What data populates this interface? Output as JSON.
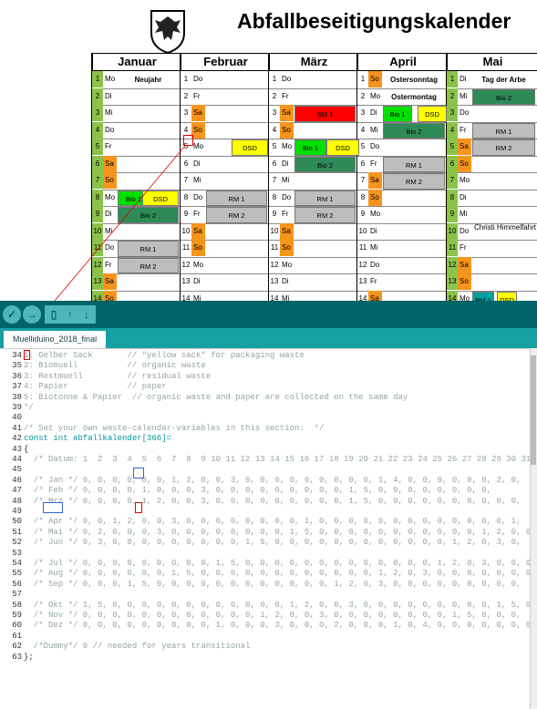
{
  "calendar": {
    "title": "Abfallbeseitigungskalender",
    "months": [
      "Januar",
      "Februar",
      "März",
      "April",
      "Mai"
    ],
    "rows": [
      [
        "1",
        "Mo",
        "Neujahr",
        "1",
        "Do",
        "",
        "1",
        "Do",
        "",
        "1",
        "So",
        "Ostersonntag",
        "1",
        "Di",
        "Tag der Arbe"
      ],
      [
        "2",
        "Di",
        "",
        "2",
        "Fr",
        "",
        "2",
        "Fr",
        "",
        "2",
        "Mo",
        "Ostermontag",
        "2",
        "Mi",
        "Bio 2"
      ],
      [
        "3",
        "Mi",
        "",
        "3",
        "Sa",
        "",
        "3",
        "Sa",
        "SM 1",
        "3",
        "Di",
        "Bio 1",
        "3",
        "Do",
        ""
      ],
      [
        "4",
        "Do",
        "",
        "4",
        "So",
        "",
        "4",
        "So",
        "",
        "4",
        "Mi",
        "Bio 2",
        "4",
        "Fr",
        "RM 1"
      ],
      [
        "5",
        "Fr",
        "",
        "5",
        "Mo",
        "DSD",
        "5",
        "Mo",
        "Bio 1",
        "5",
        "Do",
        "",
        "5",
        "Sa",
        "RM 2"
      ],
      [
        "6",
        "Sa",
        "",
        "6",
        "Di",
        "",
        "6",
        "Di",
        "Bio 2",
        "6",
        "Fr",
        "RM 1",
        "6",
        "So",
        ""
      ],
      [
        "7",
        "So",
        "",
        "7",
        "Mi",
        "",
        "7",
        "Mi",
        "",
        "7",
        "Sa",
        "RM 2",
        "7",
        "Mo",
        ""
      ],
      [
        "8",
        "Mo",
        "Bio 1",
        "8",
        "Do",
        "RM 1",
        "8",
        "Do",
        "RM 1",
        "8",
        "So",
        "",
        "8",
        "Di",
        ""
      ],
      [
        "9",
        "Di",
        "Bio 2",
        "9",
        "Fr",
        "RM 2",
        "9",
        "Fr",
        "RM 2",
        "9",
        "Mo",
        "",
        "9",
        "Mi",
        ""
      ],
      [
        "10",
        "Mi",
        "",
        "10",
        "Sa",
        "",
        "10",
        "Sa",
        "",
        "10",
        "Di",
        "",
        "10",
        "Do",
        "Christi Himmelfahrt"
      ],
      [
        "11",
        "Do",
        "RM 1",
        "11",
        "So",
        "",
        "11",
        "So",
        "",
        "11",
        "Mi",
        "",
        "11",
        "Fr",
        ""
      ],
      [
        "12",
        "Fr",
        "RM 2",
        "12",
        "Mo",
        "",
        "12",
        "Mo",
        "",
        "12",
        "Do",
        "",
        "12",
        "Sa",
        ""
      ],
      [
        "13",
        "Sa",
        "",
        "13",
        "Di",
        "",
        "13",
        "Di",
        "",
        "13",
        "Fr",
        "",
        "13",
        "So",
        ""
      ],
      [
        "14",
        "So",
        "",
        "14",
        "Mi",
        "",
        "14",
        "Mi",
        "",
        "14",
        "Sa",
        "",
        "14",
        "Mo",
        "PM 1"
      ]
    ],
    "extra_labels": {
      "dsd": "DSD",
      "christi": "Christi",
      "himmelfahrt": "Himmelfahrt"
    },
    "colors": {
      "green_light": "#8bc34a",
      "weekend_orange": "#f7941d",
      "bio1_green": "#00e000",
      "bio2_green": "#2e8b57",
      "dsd_yellow": "#ffff00",
      "rm_grey": "#bdbdbd",
      "sm_red": "#ff0000",
      "pm_teal": "#00a0a0"
    }
  },
  "ide": {
    "tab_label": "Muelliduino_2018_final",
    "toolbar": [
      "verify",
      "upload",
      "new",
      "open",
      "save"
    ],
    "lines": [
      {
        "n": "34",
        "t": "1: Gelber Sack       // \"yellow sack\" for packaging waste"
      },
      {
        "n": "35",
        "t": "2: Biomuell          // organic waste"
      },
      {
        "n": "36",
        "t": "3: Restmuell         // residual waste"
      },
      {
        "n": "37",
        "t": "4: Papier            // paper"
      },
      {
        "n": "38",
        "t": "5: Biotonne & Papier  // organic waste and paper are collected on the same day"
      },
      {
        "n": "39",
        "t": "*/"
      },
      {
        "n": "40",
        "t": ""
      },
      {
        "n": "41",
        "t": "/* Set your own waste-calendar-variables in this section:  */"
      },
      {
        "n": "42",
        "t": "const int abfallkalender[366]="
      },
      {
        "n": "43",
        "t": "{"
      },
      {
        "n": "44",
        "t": "  /* Datum: 1  2  3  4  5  6  7  8  9 10 11 12 13 14 15 16 17 18 19 20 21 22 23 24 25 26 27 28 29 30 31 */"
      },
      {
        "n": "45",
        "t": ""
      },
      {
        "n": "46",
        "t": "  /* Jan */ 0, 0, 0, 0, 0, 0, 1, 2, 0, 0, 3, 0, 0, 0, 0, 0, 0, 0, 0, 0, 1, 4, 0, 0, 0, 0, 0, 0, 2, 0,"
      },
      {
        "n": "47",
        "t": "  /* Feb */ 0, 0, 0, 0, 1, 0, 0, 0, 3, 0, 0, 0, 0, 0, 0, 0, 0, 0, 1, 5, 0, 0, 0, 0, 0, 0, 0, 0,"
      },
      {
        "n": "48",
        "t": "  /* Mrz */ 0, 0, 0, 0, 1, 2, 0, 0, 3, 0, 0, 0, 0, 0, 0, 0, 0, 0, 1, 5, 0, 0, 0, 0, 0, 0, 0, 0, 0, 0,"
      },
      {
        "n": "49",
        "t": ""
      },
      {
        "n": "50",
        "t": "  /* Apr */ 0, 0, 1, 2, 0, 0, 3, 0, 0, 0, 0, 0, 0, 0, 0, 1, 0, 0, 0, 0, 0, 0, 0, 0, 0, 0, 0, 0, 0, 1,"
      },
      {
        "n": "51",
        "t": "  /* Mai */ 0, 2, 0, 0, 0, 3, 0, 0, 0, 0, 0, 0, 0, 0, 1, 5, 0, 0, 0, 0, 0, 0, 0, 0, 0, 0, 0, 1, 2, 0, 0,"
      },
      {
        "n": "52",
        "t": "  /* Jun */ 0, 3, 0, 0, 0, 0, 0, 0, 0, 0, 0, 1, 5, 0, 0, 0, 0, 0, 0, 0, 0, 0, 0, 0, 0, 1, 2, 0, 3, 0,"
      },
      {
        "n": "53",
        "t": ""
      },
      {
        "n": "54",
        "t": "  /* Jul */ 0, 0, 0, 0, 0, 0, 0, 0, 0, 1, 5, 0, 0, 0, 0, 0, 0, 0, 0, 0, 0, 0, 0, 0, 1, 2, 0, 3, 0, 0, 0,"
      },
      {
        "n": "55",
        "t": "  /* Aug */ 0, 0, 0, 0, 0, 0, 1, 5, 0, 0, 0, 0, 0, 0, 0, 0, 0, 0, 0, 0, 1, 2, 0, 3, 0, 0, 0, 0, 0, 0, 0,"
      },
      {
        "n": "56",
        "t": "  /* Sep */ 0, 0, 0, 1, 5, 0, 0, 0, 0, 0, 0, 0, 0, 0, 0, 0, 0, 1, 2, 0, 3, 0, 0, 0, 0, 0, 0, 0, 0, 0,"
      },
      {
        "n": "57",
        "t": ""
      },
      {
        "n": "58",
        "t": "  /* Okt */ 1, 5, 0, 0, 0, 0, 0, 0, 0, 0, 0, 0, 0, 0, 1, 2, 0, 0, 3, 0, 0, 0, 0, 0, 0, 0, 0, 0, 1, 5, 0,"
      },
      {
        "n": "59",
        "t": "  /* Nov */ 0, 0, 0, 0, 0, 0, 0, 0, 0, 0, 0, 0, 1, 2, 0, 0, 3, 0, 0, 0, 0, 0, 0, 0, 0, 1, 5, 0, 0, 0,"
      },
      {
        "n": "60",
        "t": "  /* Dez */ 0, 0, 0, 0, 0, 0, 0, 0, 0, 1, 0, 0, 0, 3, 0, 0, 0, 2, 0, 0, 0, 1, 0, 4, 0, 0, 0, 0, 0, 0, 0,"
      },
      {
        "n": "61",
        "t": ""
      },
      {
        "n": "62",
        "t": "  /*Dummy*/ 0 // needed for years transitional"
      },
      {
        "n": "63",
        "t": "};"
      }
    ]
  }
}
